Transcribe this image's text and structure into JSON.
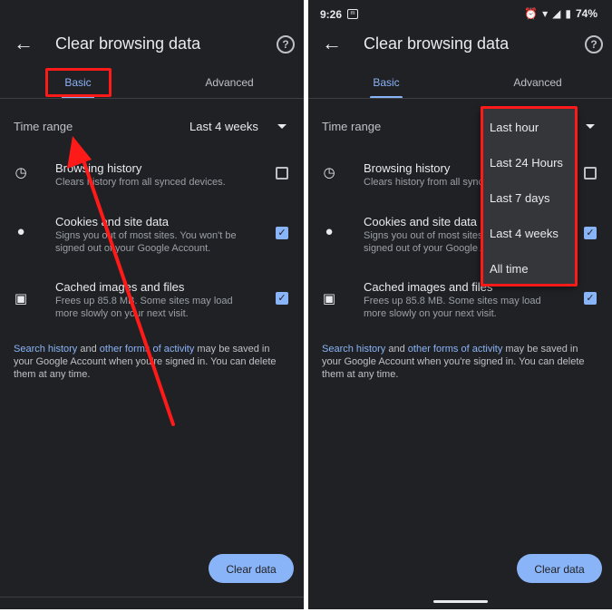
{
  "left": {
    "title": "Clear browsing data",
    "tabs": [
      "Basic",
      "Advanced"
    ],
    "time_range": {
      "label": "Time range",
      "value": "Last 4 weeks"
    },
    "options": [
      {
        "title": "Browsing history",
        "desc": "Clears history from all synced devices.",
        "checked": false,
        "icon": "clock-icon"
      },
      {
        "title": "Cookies and site data",
        "desc": "Signs you out of most sites. You won't be signed out of your Google Account.",
        "checked": true,
        "icon": "cookie-icon"
      },
      {
        "title": "Cached images and files",
        "desc": "Frees up 85.8 MB. Some sites may load more slowly on your next visit.",
        "checked": true,
        "icon": "image-icon"
      }
    ],
    "footer": {
      "link1": "Search history",
      "mid": " and ",
      "link2": "other forms of activity",
      "rest": " may be saved in your Google Account when you're signed in. You can delete them at any time."
    },
    "clear_button": "Clear data"
  },
  "right": {
    "status_bar": {
      "time": "9:26",
      "battery": "74%"
    },
    "title": "Clear browsing data",
    "tabs": [
      "Basic",
      "Advanced"
    ],
    "time_range": {
      "label": "Time range"
    },
    "options": [
      {
        "title": "Browsing history",
        "desc": "Clears history from all synced devices.",
        "checked": false,
        "icon": "clock-icon"
      },
      {
        "title": "Cookies and site data",
        "desc": "Signs you out of most sites. You won't be signed out of your Google Account.",
        "checked": true,
        "icon": "cookie-icon"
      },
      {
        "title": "Cached images and files",
        "desc": "Frees up 85.8 MB. Some sites may load more slowly on your next visit.",
        "checked": true,
        "icon": "image-icon"
      }
    ],
    "footer": {
      "link1": "Search history",
      "mid": " and ",
      "link2": "other forms of activity",
      "rest": " may be saved in your Google Account when you're signed in. You can delete them at any time."
    },
    "clear_button": "Clear data",
    "menu_items": [
      "Last hour",
      "Last 24 Hours",
      "Last 7 days",
      "Last 4 weeks",
      "All time"
    ]
  },
  "colors": {
    "background": "#202124",
    "accent": "#8ab4f8",
    "annotation": "#ff1a1a"
  }
}
